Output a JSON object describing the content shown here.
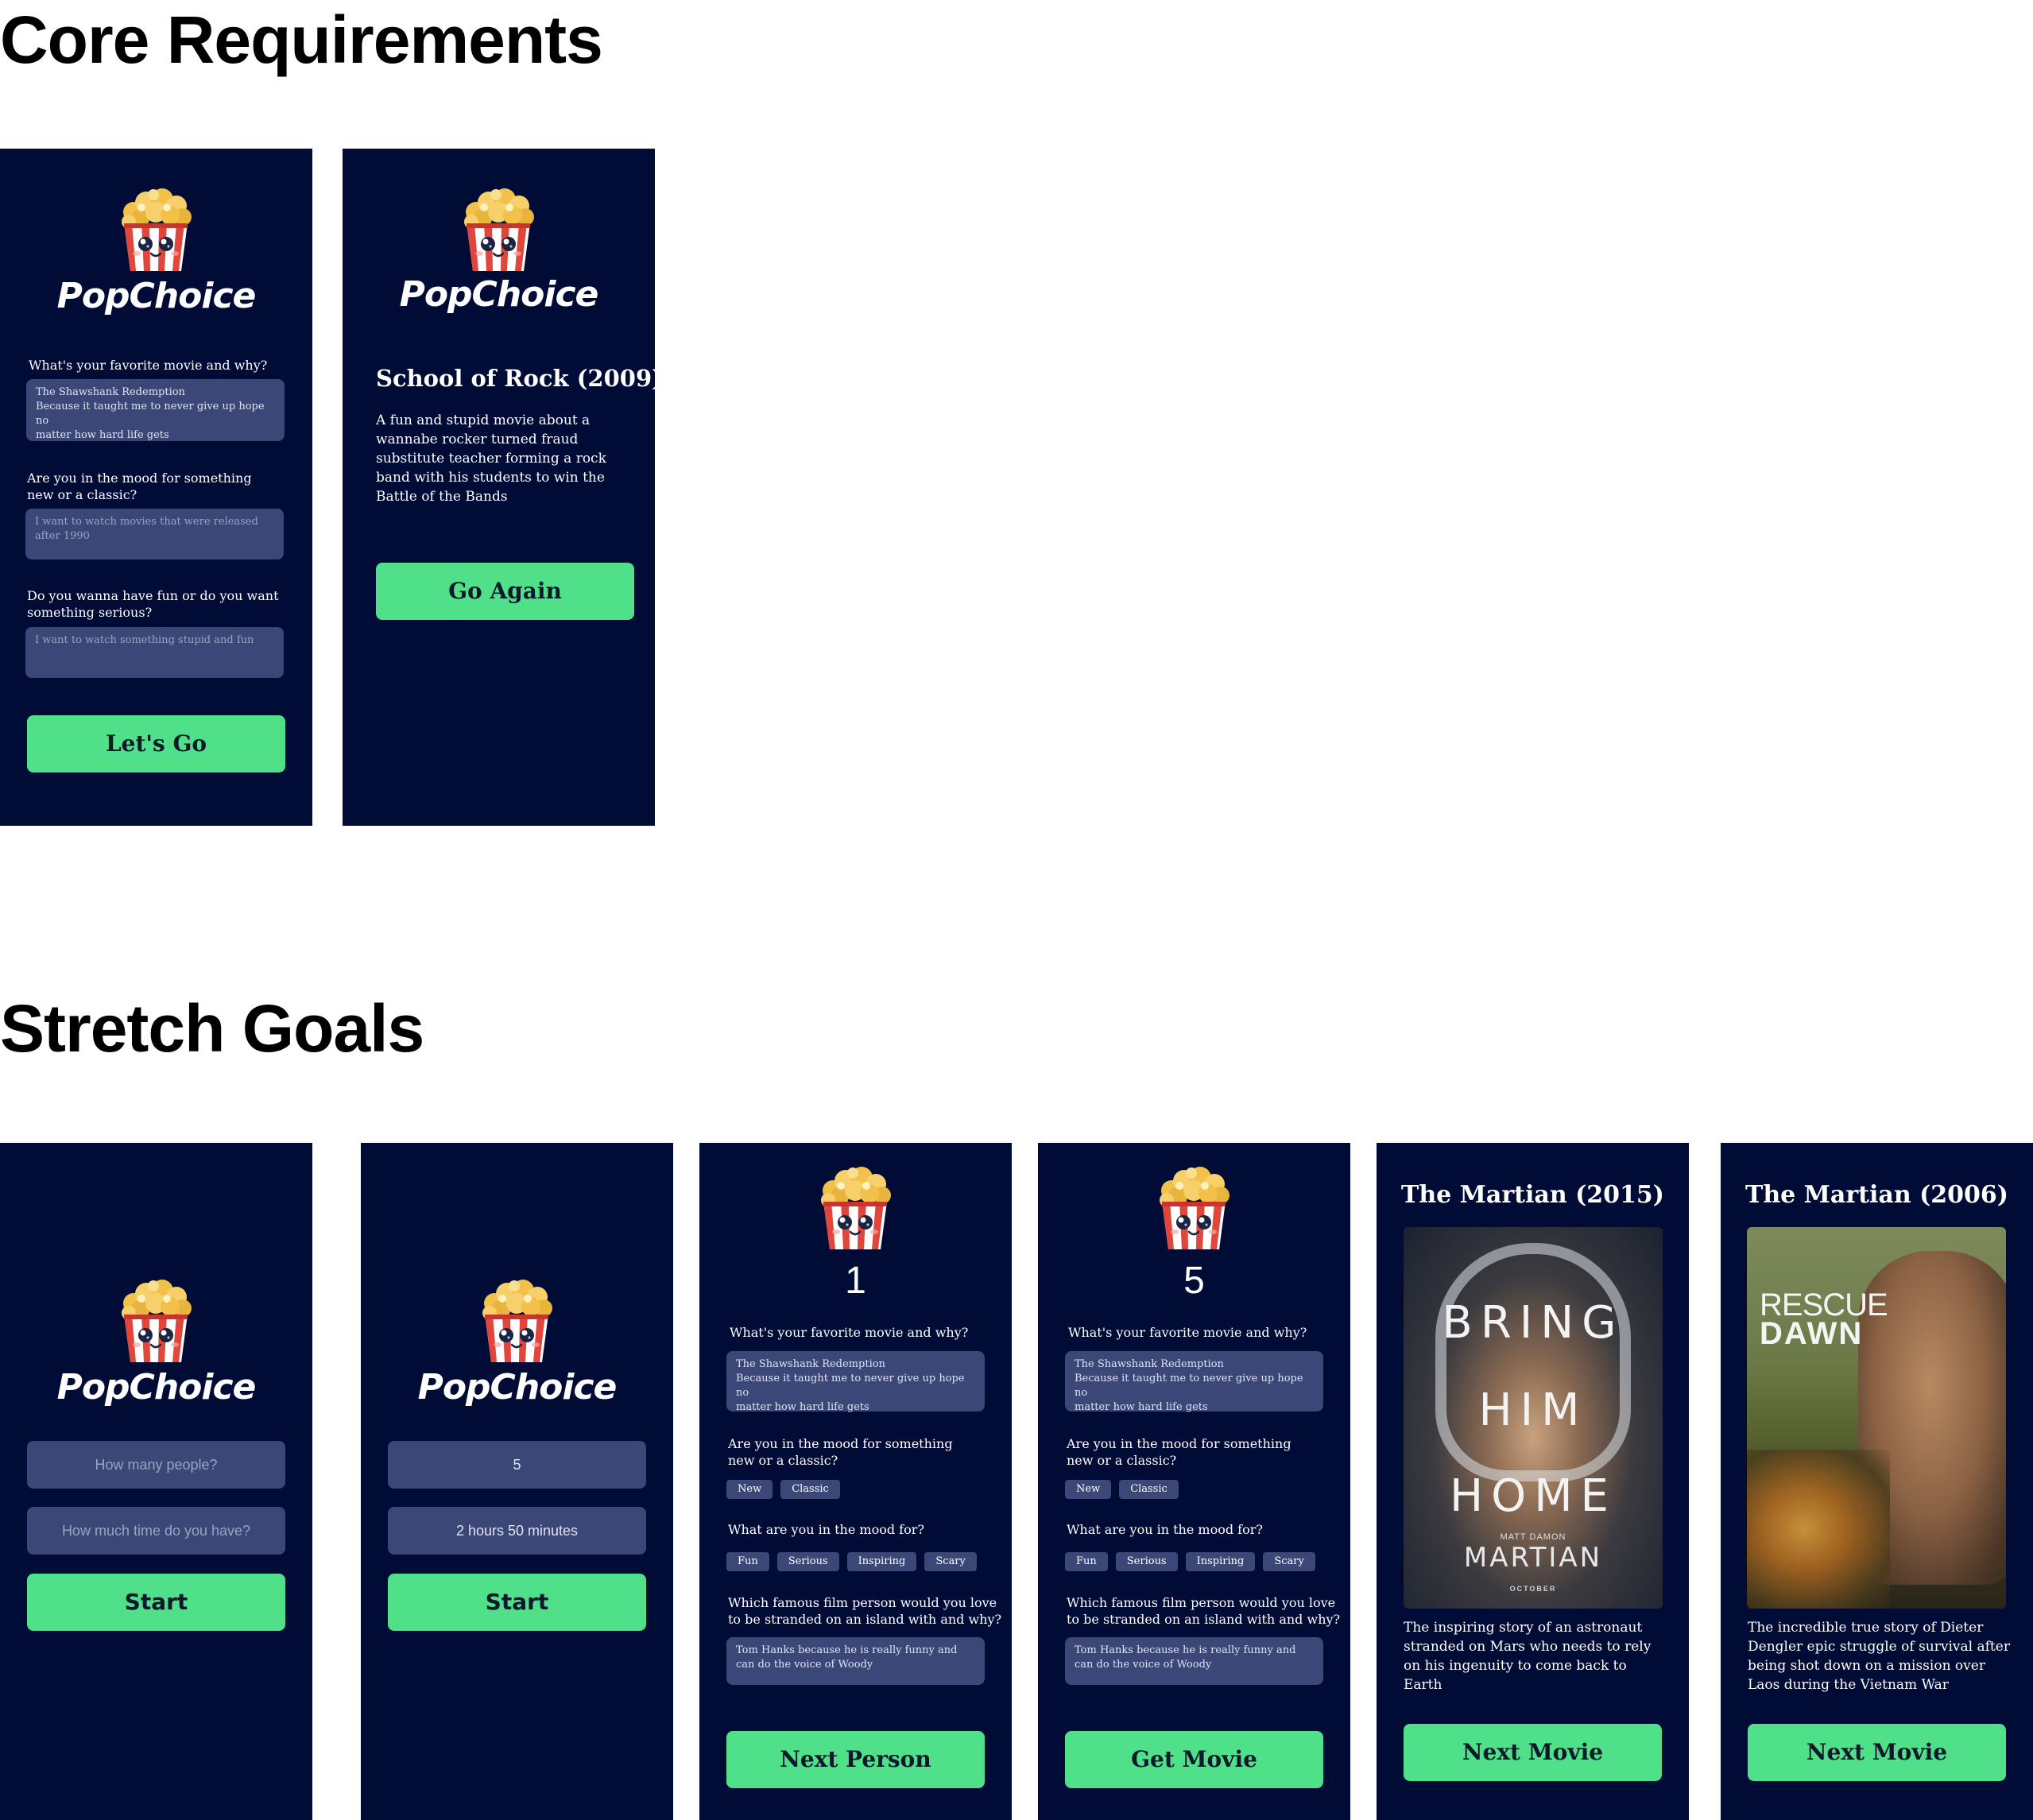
{
  "sections": {
    "core": "Core Requirements",
    "stretch": "Stretch Goals"
  },
  "brand": {
    "name": "PopChoice",
    "icon": "popcorn-icon"
  },
  "core_input": {
    "q1": "What's your favorite movie and why?",
    "a1_line1": "The Shawshank Redemption",
    "a1_line2": "Because it taught me to never give up hope no",
    "a1_line3": "matter how hard life gets",
    "q2_line1": "Are you in the mood for something",
    "q2_line2": "new or a classic?",
    "a2_line1": "I want to watch movies that were released",
    "a2_line2": "after 1990",
    "q3_line1": "Do you wanna have fun or do you want",
    "q3_line2": "something serious?",
    "a3": "I want to watch something stupid and fun",
    "button": "Let's Go"
  },
  "core_result": {
    "title": "School of Rock (2009)",
    "desc": [
      "A fun and stupid movie about a",
      "wannabe rocker turned fraud",
      "substitute teacher forming a rock",
      "band with his students to win the",
      "Battle of the Bands"
    ],
    "button": "Go Again"
  },
  "stretch_start_empty": {
    "people_placeholder": "How many people?",
    "time_placeholder": "How much time do you have?",
    "button": "Start"
  },
  "stretch_start_filled": {
    "people": "5",
    "time": "2 hours 50 minutes",
    "button": "Start"
  },
  "stretch_person": {
    "q1": "What's your favorite movie and why?",
    "a1_line1": "The Shawshank Redemption",
    "a1_line2": "Because it taught me to never give up hope no",
    "a1_line3": "matter how hard life gets",
    "q2_line1": "Are you in the mood for something",
    "q2_line2": "new or a classic?",
    "era_options": [
      "New",
      "Classic"
    ],
    "q3": "What are you in the mood for?",
    "mood_options": [
      "Fun",
      "Serious",
      "Inspiring",
      "Scary"
    ],
    "q4_line1": "Which famous film person would you love",
    "q4_line2": "to be stranded on an island with and why?",
    "a4_line1": "Tom Hanks because he is really funny and",
    "a4_line2": "can do the voice of Woody"
  },
  "person_first": {
    "number": "1",
    "button": "Next Person"
  },
  "person_last": {
    "number": "5",
    "button": "Get Movie"
  },
  "movie_1": {
    "title": "The Martian (2015)",
    "poster": {
      "line1": "BRING",
      "line2": "HIM",
      "line3": "HOME",
      "actor": "MATT DAMON",
      "name": "MARTIAN",
      "month": "OCTOBER"
    },
    "desc": [
      "The inspiring story of an astronaut",
      "stranded on Mars who needs to rely",
      "on his ingenuity to come back to",
      "Earth"
    ],
    "button": "Next Movie"
  },
  "movie_2": {
    "title": "The Martian (2006)",
    "poster": {
      "line1": "RESCUE",
      "line2": "DAWN"
    },
    "desc": [
      "The incredible true story of Dieter",
      "Dengler epic struggle of survival after",
      "being shot down on a mission over",
      "Laos during the Vietnam War"
    ],
    "button": "Next Movie"
  },
  "colors": {
    "screen_bg": "#000c36",
    "field_bg": "#3b4877",
    "button_bg": "#51e08a",
    "button_text": "#0a1a2a"
  }
}
